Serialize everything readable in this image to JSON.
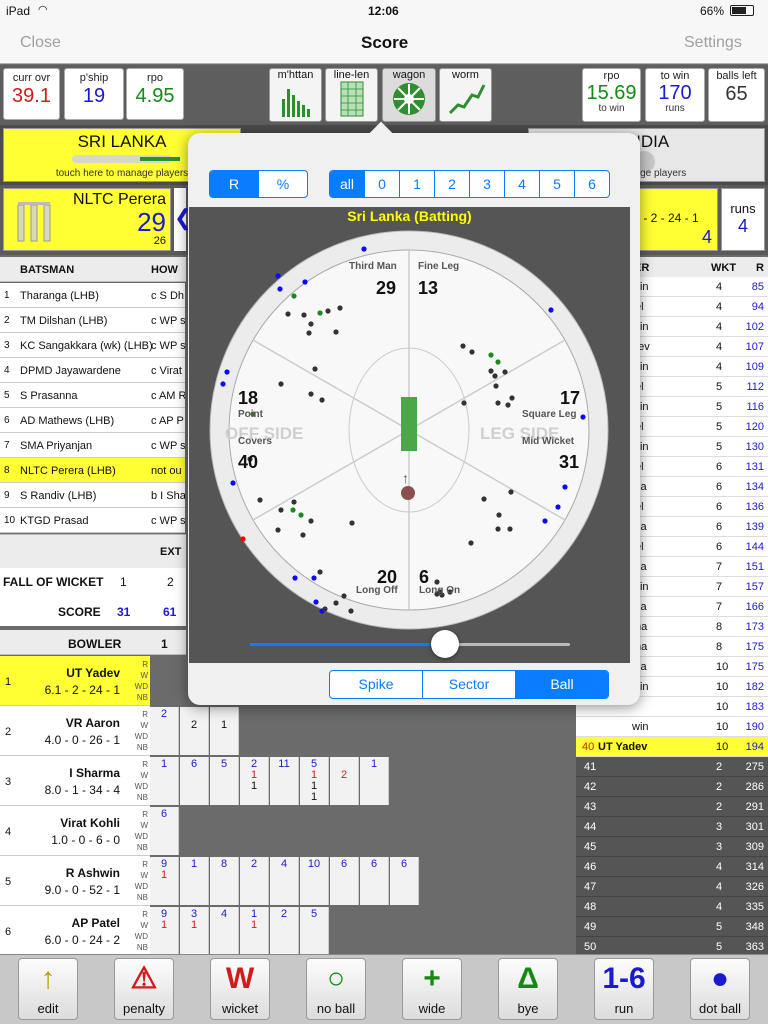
{
  "status": {
    "device": "iPad",
    "time": "12:06",
    "battery": "66%"
  },
  "nav": {
    "close": "Close",
    "title": "Score",
    "settings": "Settings"
  },
  "stats": {
    "curr_ovr_label": "curr ovr",
    "curr_ovr": "39.1",
    "pship_label": "p'ship",
    "pship": "19",
    "rpo_label": "rpo",
    "rpo": "4.95",
    "rpo2_label": "rpo",
    "rpo2": "15.69",
    "rpo2_sub": "to win",
    "to_win_label": "to win",
    "to_win": "170",
    "to_win_sub": "runs",
    "balls_left_label": "balls left",
    "balls_left": "65"
  },
  "views": [
    {
      "label": "m'httan",
      "icon": "manhattan-icon"
    },
    {
      "label": "line-len",
      "icon": "line-length-icon"
    },
    {
      "label": "wagon",
      "icon": "wagon-wheel-icon"
    },
    {
      "label": "worm",
      "icon": "worm-icon"
    }
  ],
  "teams": {
    "batting": "SRI LANKA",
    "batting_hint": "touch here to manage players",
    "bowling": "INDIA",
    "bowling_hint": "o manage players"
  },
  "striker": {
    "name": "NLTC Perera",
    "runs": "29",
    "balls": "26"
  },
  "bowler_current": {
    "figures": "rs - 2 - 24 - 1",
    "runs_label": "runs",
    "runs": "4",
    "extra": "4"
  },
  "batting_table": {
    "col1": "BATSMAN",
    "col2": "HOW",
    "rows": [
      {
        "no": "1",
        "name": "Tharanga (LHB)",
        "how": "c S Dh"
      },
      {
        "no": "2",
        "name": "TM Dilshan (LHB)",
        "how": "c WP s"
      },
      {
        "no": "3",
        "name": "KC Sangakkara (wk) (LHB)",
        "how": "c WP s"
      },
      {
        "no": "4",
        "name": "DPMD Jayawardene",
        "how": "c Virat"
      },
      {
        "no": "5",
        "name": "S Prasanna",
        "how": "c AM R"
      },
      {
        "no": "6",
        "name": "AD Mathews (LHB)",
        "how": "c AP P"
      },
      {
        "no": "7",
        "name": "SMA Priyanjan",
        "how": "c WP s"
      },
      {
        "no": "8",
        "name": "NLTC Perera (LHB)",
        "how": "not ou"
      },
      {
        "no": "9",
        "name": "S Randiv (LHB)",
        "how": "b I Sha"
      },
      {
        "no": "10",
        "name": "KTGD Prasad",
        "how": "c WP s"
      }
    ],
    "extras_label": "EXT"
  },
  "fow": {
    "label": "FALL OF WICKET",
    "w1": "1",
    "w2": "2",
    "score_label": "SCORE",
    "s1": "31",
    "s2": "61"
  },
  "bowling": {
    "header": "BOWLER",
    "col1": "1",
    "rows": [
      {
        "no": "1",
        "name": "UT Yadev",
        "fig": "6.1 - 2 - 24 - 1"
      },
      {
        "no": "2",
        "name": "VR Aaron",
        "fig": "4.0 - 0 - 26 - 1"
      },
      {
        "no": "3",
        "name": "I Sharma",
        "fig": "8.0 - 1 - 34 - 4"
      },
      {
        "no": "4",
        "name": "Virat Kohli",
        "fig": "1.0 - 0 - 6 - 0"
      },
      {
        "no": "5",
        "name": "R Ashwin",
        "fig": "9.0 - 0 - 52 - 1"
      },
      {
        "no": "6",
        "name": "AP Patel",
        "fig": "6.0 - 0 - 24 - 2"
      }
    ],
    "rw": [
      "R",
      "W",
      "WD",
      "NB"
    ]
  },
  "overs": {
    "r2": [
      {
        "v": "2",
        "s": []
      },
      {
        "v": "",
        "s": [
          "2"
        ]
      },
      {
        "v": "",
        "s": [
          "1"
        ]
      }
    ],
    "r3": [
      {
        "v": "1",
        "s": []
      },
      {
        "v": "6",
        "s": []
      },
      {
        "v": "5",
        "s": []
      },
      {
        "v": "2",
        "s": [
          "1",
          "1"
        ]
      },
      {
        "v": "11",
        "s": []
      },
      {
        "v": "5",
        "s": [
          "1",
          "1",
          "1"
        ]
      },
      {
        "v": "",
        "s": [
          "2"
        ]
      },
      {
        "v": "1",
        "s": []
      }
    ],
    "r4": [
      {
        "v": "6",
        "s": []
      }
    ],
    "r5": [
      {
        "v": "9",
        "s": [
          "1"
        ]
      },
      {
        "v": "1",
        "s": []
      },
      {
        "v": "8",
        "s": []
      },
      {
        "v": "2",
        "s": []
      },
      {
        "v": "4",
        "s": []
      },
      {
        "v": "10",
        "s": []
      },
      {
        "v": "6",
        "s": []
      },
      {
        "v": "6",
        "s": []
      },
      {
        "v": "6",
        "s": []
      }
    ],
    "r6": [
      {
        "v": "9",
        "s": [
          "1"
        ]
      },
      {
        "v": "3",
        "s": [
          "1"
        ]
      },
      {
        "v": "4",
        "s": []
      },
      {
        "v": "1",
        "s": [
          "1"
        ]
      },
      {
        "v": "2",
        "s": []
      },
      {
        "v": "5",
        "s": []
      }
    ]
  },
  "right_table": {
    "c1": "ER",
    "c2": "WKT",
    "c3": "R",
    "rows": [
      {
        "a": "win",
        "w": "4",
        "r": "85"
      },
      {
        "a": "tel",
        "w": "4",
        "r": "94"
      },
      {
        "a": "win",
        "w": "4",
        "r": "102"
      },
      {
        "a": "dev",
        "w": "4",
        "r": "107"
      },
      {
        "a": "win",
        "w": "4",
        "r": "109"
      },
      {
        "a": "tel",
        "w": "5",
        "r": "112"
      },
      {
        "a": "win",
        "w": "5",
        "r": "116"
      },
      {
        "a": "tel",
        "w": "5",
        "r": "120"
      },
      {
        "a": "win",
        "w": "5",
        "r": "130"
      },
      {
        "a": "tel",
        "w": "6",
        "r": "131"
      },
      {
        "a": "ina",
        "w": "6",
        "r": "134"
      },
      {
        "a": "tel",
        "w": "6",
        "r": "136"
      },
      {
        "a": "ina",
        "w": "6",
        "r": "139"
      },
      {
        "a": "tel",
        "w": "6",
        "r": "144"
      },
      {
        "a": "ina",
        "w": "7",
        "r": "151"
      },
      {
        "a": "win",
        "w": "7",
        "r": "157"
      },
      {
        "a": "ina",
        "w": "7",
        "r": "166"
      },
      {
        "a": "ma",
        "w": "8",
        "r": "173"
      },
      {
        "a": "ma",
        "w": "8",
        "r": "175"
      },
      {
        "a": "ina",
        "w": "10",
        "r": "175"
      },
      {
        "a": "win",
        "w": "10",
        "r": "182"
      },
      {
        "a": "",
        "w": "10",
        "r": "183"
      },
      {
        "a": "win",
        "w": "10",
        "r": "190"
      },
      {
        "a": "40 UT Yadev",
        "w": "10",
        "r": "194"
      }
    ],
    "dark_rows": [
      {
        "b": "41",
        "w": "2",
        "r": "275"
      },
      {
        "b": "42",
        "w": "2",
        "r": "286"
      },
      {
        "b": "43",
        "w": "2",
        "r": "291"
      },
      {
        "b": "44",
        "w": "3",
        "r": "301"
      },
      {
        "b": "45",
        "w": "3",
        "r": "309"
      },
      {
        "b": "46",
        "w": "4",
        "r": "314"
      },
      {
        "b": "47",
        "w": "4",
        "r": "326"
      },
      {
        "b": "48",
        "w": "4",
        "r": "335"
      },
      {
        "b": "49",
        "w": "5",
        "r": "348"
      },
      {
        "b": "50",
        "w": "5",
        "r": "363"
      }
    ]
  },
  "toolbar": [
    {
      "label": "edit",
      "icon": "undo-arrow-icon"
    },
    {
      "label": "penalty",
      "icon": "warning-icon"
    },
    {
      "label": "wicket",
      "icon": "wicket-w-icon"
    },
    {
      "label": "no ball",
      "icon": "circle-icon"
    },
    {
      "label": "wide",
      "icon": "plus-icon"
    },
    {
      "label": "bye",
      "icon": "triangle-icon"
    },
    {
      "label": "run",
      "icon": "one-to-six-icon",
      "glyph": "1-6"
    },
    {
      "label": "dot ball",
      "icon": "dot-icon"
    }
  ],
  "popup": {
    "mode": [
      "R",
      "%"
    ],
    "runs_filter": [
      "all",
      "0",
      "1",
      "2",
      "3",
      "4",
      "5",
      "6"
    ],
    "title": "Sri Lanka (Batting)",
    "sectors": [
      {
        "name": "Third Man",
        "runs": "29"
      },
      {
        "name": "Fine Leg",
        "runs": "13"
      },
      {
        "name": "Point",
        "runs": "18"
      },
      {
        "name": "Square Leg",
        "runs": "17"
      },
      {
        "name": "Covers",
        "runs": "40"
      },
      {
        "name": "Mid Wicket",
        "runs": "31"
      },
      {
        "name": "Long Off",
        "runs": "20"
      },
      {
        "name": "Long On",
        "runs": "6"
      }
    ],
    "off_side": "OFF SIDE",
    "leg_side": "LEG SIDE",
    "slider_value": 0.61,
    "view_options": [
      "Spike",
      "Sector",
      "Ball"
    ],
    "view_selected": "Ball",
    "colors": {
      "accent": "#0a7cff",
      "title": "#ffff00",
      "four": "#0a0aff",
      "six": "#1a8a1a",
      "wicket": "#ff0000"
    }
  }
}
